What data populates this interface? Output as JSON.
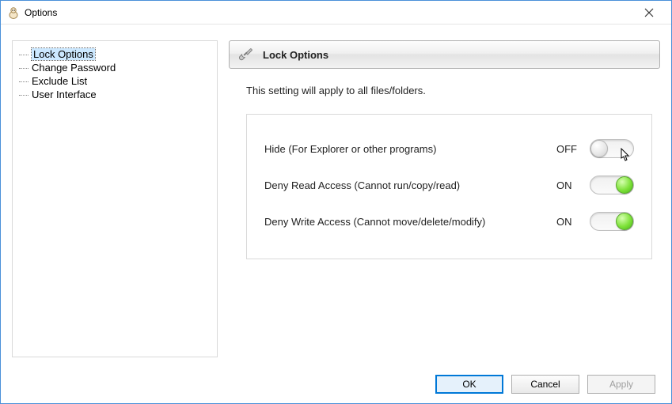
{
  "window": {
    "title": "Options"
  },
  "sidebar": {
    "items": [
      {
        "label": "Lock Options",
        "selected": true
      },
      {
        "label": "Change Password",
        "selected": false
      },
      {
        "label": "Exclude List",
        "selected": false
      },
      {
        "label": "User Interface",
        "selected": false
      }
    ]
  },
  "panel": {
    "title": "Lock Options",
    "description": "This setting will apply to all files/folders.",
    "settings": [
      {
        "label": "Hide (For Explorer or other programs)",
        "state": "OFF",
        "on": false
      },
      {
        "label": "Deny Read Access (Cannot run/copy/read)",
        "state": "ON",
        "on": true
      },
      {
        "label": "Deny Write Access (Cannot move/delete/modify)",
        "state": "ON",
        "on": true
      }
    ]
  },
  "buttons": {
    "ok": "OK",
    "cancel": "Cancel",
    "apply": "Apply"
  }
}
